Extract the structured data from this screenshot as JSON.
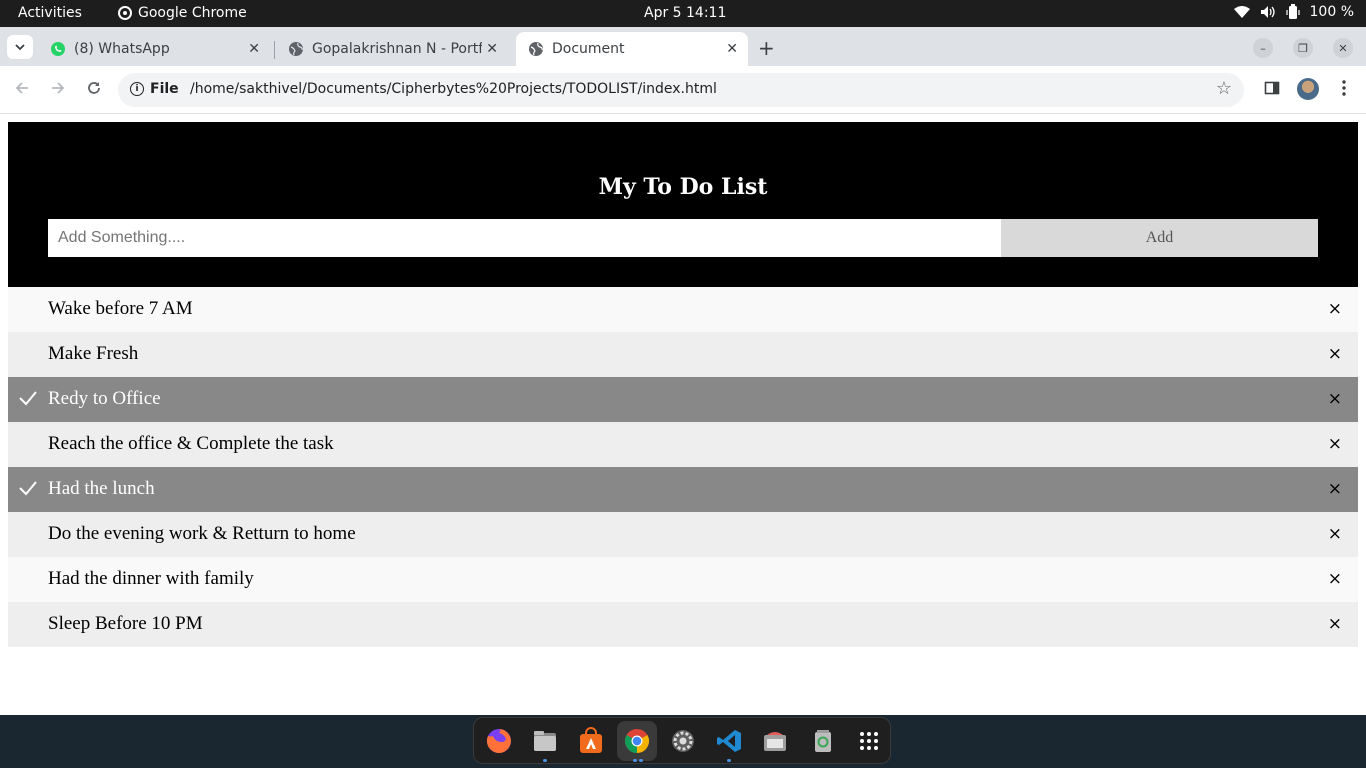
{
  "system": {
    "activities": "Activities",
    "app_name": "Google Chrome",
    "clock": "Apr 5  14:11",
    "battery": "100 %"
  },
  "tabs": [
    {
      "title": "(8) WhatsApp",
      "icon": "whatsapp-icon"
    },
    {
      "title": "Gopalakrishnan N - Portf",
      "icon": "globe-icon"
    },
    {
      "title": "Document",
      "icon": "globe-icon",
      "active": true
    }
  ],
  "omnibox": {
    "scheme_label": "File",
    "url": "/home/sakthivel/Documents/Cipherbytes%20Projects/TODOLIST/index.html"
  },
  "page": {
    "heading": "My To Do List",
    "input_placeholder": "Add Something....",
    "add_label": "Add",
    "close_glyph": "×",
    "items": [
      {
        "text": "Wake before 7 AM",
        "checked": false
      },
      {
        "text": "Make Fresh",
        "checked": false
      },
      {
        "text": "Redy to Office",
        "checked": true
      },
      {
        "text": "Reach the office & Complete the task",
        "checked": false
      },
      {
        "text": "Had the lunch",
        "checked": true
      },
      {
        "text": "Do the evening work & Retturn to home",
        "checked": false
      },
      {
        "text": "Had the dinner with family",
        "checked": false
      },
      {
        "text": "Sleep Before 10 PM",
        "checked": false
      }
    ]
  },
  "dock": [
    "firefox-icon",
    "files-icon",
    "software-center-icon",
    "chrome-icon",
    "settings-icon",
    "vscode-icon",
    "screenshot-icon",
    "trash-icon",
    "app-grid-icon"
  ],
  "colors": {
    "header_bg": "#000000",
    "checked_row": "#888888",
    "odd_row": "#f9f9f9",
    "even_row": "#eeeeee"
  }
}
